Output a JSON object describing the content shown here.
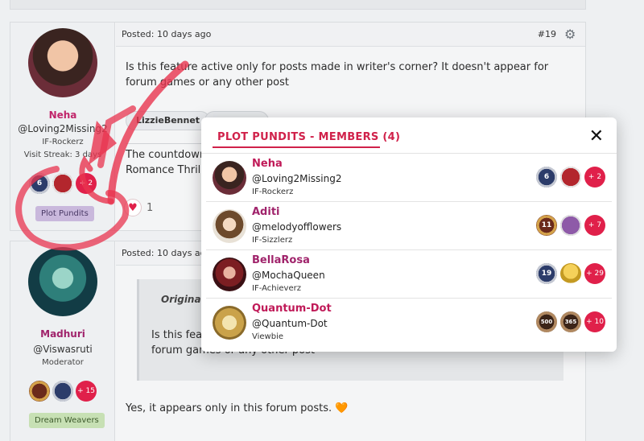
{
  "post1": {
    "posted": "Posted: 10 days ago",
    "post_number": "#19",
    "user": {
      "name": "Neha",
      "name_color": "#c0256a",
      "handle": "@Loving2Missing2",
      "rank": "IF-Rockerz",
      "streak": "Visit Streak: 3 days",
      "badge_plus": "+ 2",
      "badge_num": "6",
      "group": "Plot Pundits"
    },
    "text": "Is this feature active only for posts made in writer's corner? It doesn't appear for forum games or any other post",
    "tag1": "LizzieBennet",
    "text2_line1": "The countdown",
    "text2_line2": "Romance Thrille",
    "reaction_count": "1"
  },
  "post2": {
    "posted": "Posted: 10 days ago",
    "user": {
      "name": "Madhuri",
      "name_color": "#a0236b",
      "handle": "@Viswasruti",
      "rank": "Moderator",
      "badge_plus": "+ 15",
      "group": "Dream Weavers"
    },
    "quote_head": "Originally p",
    "quote_line1": "Is this featu",
    "quote_line2": "forum games or any other post",
    "reply": "Yes, it appears only in this forum posts. 🧡"
  },
  "modal": {
    "title": "PLOT PUNDITS - MEMBERS (4)",
    "close": "✕",
    "members": [
      {
        "name": "Neha",
        "handle": "@Loving2Missing2",
        "rank": "IF-Rockerz",
        "plus": "+ 2",
        "badge_num": "6"
      },
      {
        "name": "Aditi",
        "handle": "@melodyofflowers",
        "rank": "IF-Sizzlerz",
        "plus": "+ 7",
        "badge_num": "11"
      },
      {
        "name": "BellaRosa",
        "handle": "@MochaQueen",
        "rank": "IF-Achieverz",
        "plus": "+ 29",
        "badge_num": "19"
      },
      {
        "name": "Quantum-Dot",
        "handle": "@Quantum-Dot",
        "rank": "Viewbie",
        "plus": "+ 10",
        "badge_num": "500",
        "badge_num2": "365"
      }
    ]
  },
  "colors": {
    "accent": "#d0214a",
    "arrow": "#e8344f",
    "plot_pundits_tag": "#c9b8dc",
    "dream_weavers_tag": "#c7e0b4"
  }
}
